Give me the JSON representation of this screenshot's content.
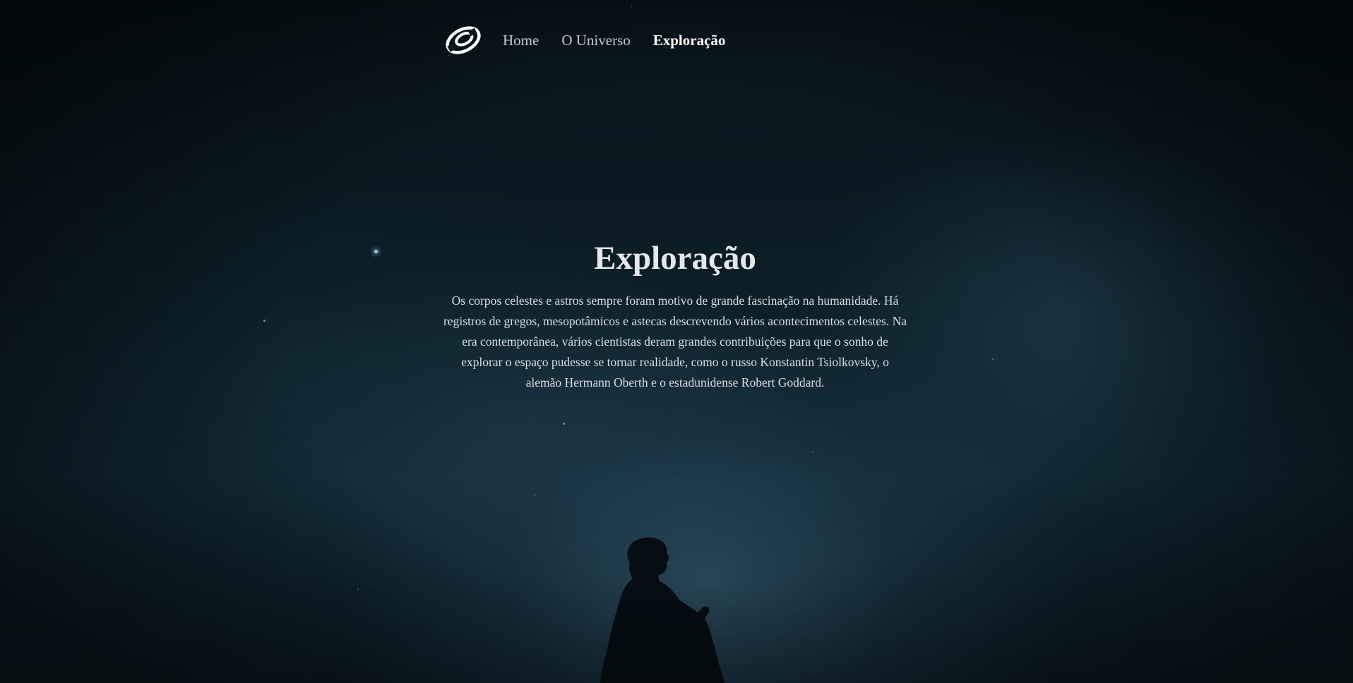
{
  "nav": {
    "logo_icon": "galaxy-logo-icon",
    "items": [
      {
        "label": "Home",
        "active": false
      },
      {
        "label": "O Universo",
        "active": false
      },
      {
        "label": "Exploração",
        "active": true
      }
    ]
  },
  "hero": {
    "title": "Exploração",
    "paragraph": "Os corpos celestes e astros sempre foram motivo de grande fascinação na humanidade. Há registros de gregos, mesopotâmicos e astecas descrevendo vários acontecimentos celestes. Na era contemporânea, vários cientistas deram grandes contribuições para que o sonho de explorar o espaço pudesse se tornar realidade, como o russo Konstantin Tsiolkovsky, o alemão Hermann Oberth e o estadunidense Robert Goddard."
  },
  "colors": {
    "background": "#07141b",
    "text": "#d9dfe3",
    "active_link": "#ffffff"
  }
}
